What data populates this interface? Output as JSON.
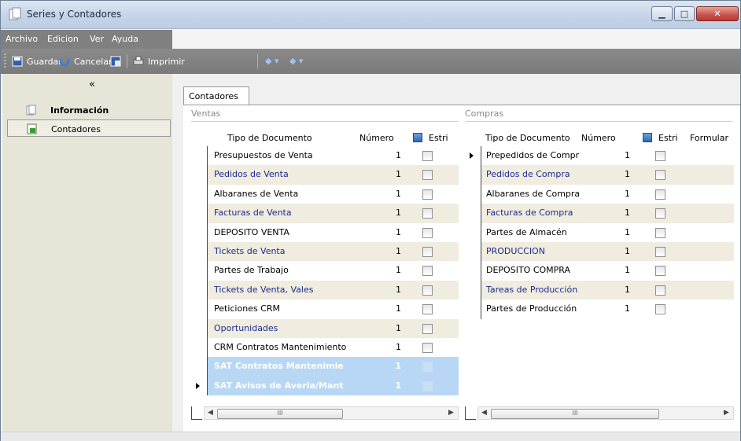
{
  "window": {
    "title": "Series y Contadores"
  },
  "menu": [
    "Archivo",
    "Edicion",
    "Ver",
    "Ayuda"
  ],
  "toolbar": {
    "save": "Guardar",
    "cancel": "Cancelar",
    "print": "Imprimir"
  },
  "sidebar": {
    "collapse": "«",
    "items": [
      {
        "label": "Información"
      },
      {
        "label": "Contadores"
      }
    ]
  },
  "tabs": [
    {
      "label": "Contadores"
    }
  ],
  "ventas": {
    "title": "Ventas",
    "headers": {
      "tipo": "Tipo de Documento",
      "numero": "Número",
      "estricto": "Estri"
    },
    "rows": [
      {
        "tipo": "Presupuestos de Venta",
        "numero": "1"
      },
      {
        "tipo": "Pedidos de Venta",
        "numero": "1"
      },
      {
        "tipo": "Albaranes de Venta",
        "numero": "1"
      },
      {
        "tipo": "Facturas de Venta",
        "numero": "1"
      },
      {
        "tipo": "DEPOSITO VENTA",
        "numero": "1"
      },
      {
        "tipo": "Tickets de Venta",
        "numero": "1"
      },
      {
        "tipo": "Partes de Trabajo",
        "numero": "1"
      },
      {
        "tipo": "Tickets de Venta, Vales",
        "numero": "1"
      },
      {
        "tipo": "Peticiones CRM",
        "numero": "1"
      },
      {
        "tipo": "Oportunidades",
        "numero": "1"
      },
      {
        "tipo": "CRM Contratos Mantenimiento",
        "numero": "1"
      },
      {
        "tipo": "SAT Contratos Mantenimie",
        "numero": "1"
      },
      {
        "tipo": "SAT Avisos de Averia/Mant",
        "numero": "1"
      }
    ]
  },
  "compras": {
    "title": "Compras",
    "headers": {
      "tipo": "Tipo de Documento",
      "numero": "Número",
      "estricto": "Estri",
      "formular": "Formular"
    },
    "rows": [
      {
        "tipo": "Prepedidos de Compr",
        "numero": "1"
      },
      {
        "tipo": "Pedidos de Compra",
        "numero": "1"
      },
      {
        "tipo": "Albaranes de Compra",
        "numero": "1"
      },
      {
        "tipo": "Facturas de Compra",
        "numero": "1"
      },
      {
        "tipo": "Partes de Almacén",
        "numero": "1"
      },
      {
        "tipo": "PRODUCCION",
        "numero": "1"
      },
      {
        "tipo": "DEPOSITO COMPRA",
        "numero": "1"
      },
      {
        "tipo": "Tareas de Producción",
        "numero": "1"
      },
      {
        "tipo": "Partes de Producción",
        "numero": "1"
      }
    ]
  },
  "scroll": {
    "thumb": "III"
  }
}
